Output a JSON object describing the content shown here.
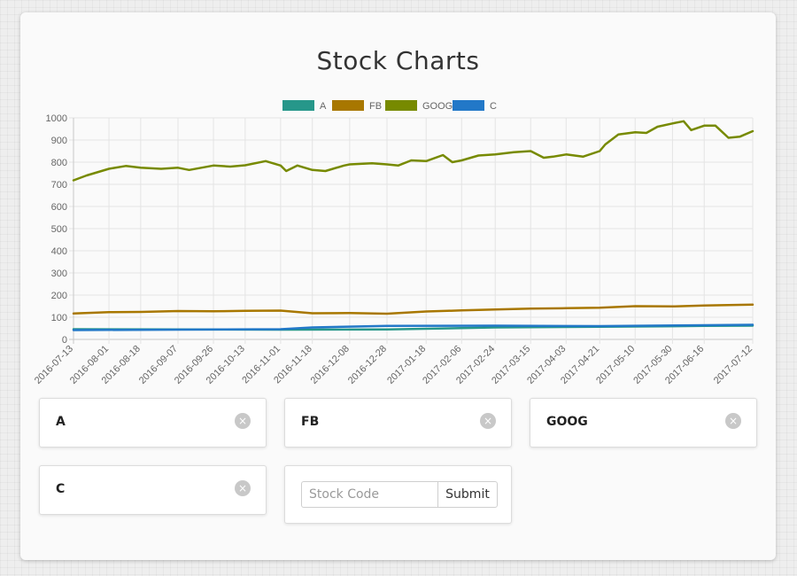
{
  "page": {
    "title": "Stock Charts"
  },
  "chart_data": {
    "type": "line",
    "ylim": [
      0,
      1000
    ],
    "yticks": [
      0,
      100,
      200,
      300,
      400,
      500,
      600,
      700,
      800,
      900,
      1000
    ],
    "xrange": [
      "2016-07-13",
      "2017-07-12"
    ],
    "xticks": [
      "2016-07-13",
      "2016-08-01",
      "2016-08-18",
      "2016-09-07",
      "2016-09-26",
      "2016-10-13",
      "2016-11-01",
      "2016-11-18",
      "2016-12-08",
      "2016-12-28",
      "2017-01-18",
      "2017-02-06",
      "2017-02-24",
      "2017-03-15",
      "2017-04-03",
      "2017-04-21",
      "2017-05-10",
      "2017-05-30",
      "2017-06-16",
      "2017-07-12"
    ],
    "grid": true,
    "legend_position": "top",
    "series": [
      {
        "name": "A",
        "color": "#26978a",
        "x": [
          "2016-07-13",
          "2016-09-07",
          "2016-11-01",
          "2016-12-28",
          "2017-02-24",
          "2017-04-21",
          "2017-06-16",
          "2017-07-12"
        ],
        "values": [
          46,
          45,
          44,
          45,
          54,
          57,
          61,
          62
        ]
      },
      {
        "name": "FB",
        "color": "#a87700",
        "x": [
          "2016-07-13",
          "2016-08-01",
          "2016-08-18",
          "2016-09-07",
          "2016-09-26",
          "2016-10-13",
          "2016-11-01",
          "2016-11-18",
          "2016-12-08",
          "2016-12-28",
          "2017-01-18",
          "2017-02-06",
          "2017-02-24",
          "2017-03-15",
          "2017-04-03",
          "2017-04-21",
          "2017-05-10",
          "2017-05-30",
          "2017-06-16",
          "2017-07-12"
        ],
        "values": [
          117,
          123,
          124,
          128,
          127,
          129,
          130,
          118,
          119,
          116,
          126,
          131,
          135,
          139,
          141,
          143,
          150,
          149,
          153,
          157
        ]
      },
      {
        "name": "GOOG",
        "color": "#778a00",
        "x": [
          "2016-07-13",
          "2016-07-20",
          "2016-08-01",
          "2016-08-10",
          "2016-08-18",
          "2016-08-29",
          "2016-09-07",
          "2016-09-13",
          "2016-09-26",
          "2016-10-05",
          "2016-10-13",
          "2016-10-24",
          "2016-11-01",
          "2016-11-04",
          "2016-11-10",
          "2016-11-18",
          "2016-11-25",
          "2016-12-05",
          "2016-12-08",
          "2016-12-20",
          "2016-12-28",
          "2017-01-03",
          "2017-01-10",
          "2017-01-18",
          "2017-01-27",
          "2017-02-01",
          "2017-02-06",
          "2017-02-15",
          "2017-02-24",
          "2017-03-06",
          "2017-03-15",
          "2017-03-22",
          "2017-03-27",
          "2017-04-03",
          "2017-04-12",
          "2017-04-21",
          "2017-04-24",
          "2017-05-01",
          "2017-05-10",
          "2017-05-16",
          "2017-05-22",
          "2017-05-30",
          "2017-06-05",
          "2017-06-09",
          "2017-06-16",
          "2017-06-22",
          "2017-06-29",
          "2017-07-05",
          "2017-07-12"
        ],
        "values": [
          718,
          740,
          770,
          783,
          775,
          770,
          775,
          765,
          785,
          780,
          786,
          805,
          785,
          760,
          785,
          765,
          760,
          785,
          790,
          795,
          790,
          785,
          808,
          805,
          832,
          800,
          808,
          830,
          835,
          845,
          850,
          820,
          825,
          835,
          825,
          850,
          880,
          925,
          935,
          932,
          960,
          975,
          985,
          945,
          965,
          965,
          910,
          915,
          940
        ]
      },
      {
        "name": "C",
        "color": "#2278c8",
        "x": [
          "2016-07-13",
          "2016-09-07",
          "2016-11-01",
          "2016-11-18",
          "2016-12-28",
          "2017-02-24",
          "2017-04-21",
          "2017-06-16",
          "2017-07-12"
        ],
        "values": [
          42,
          44,
          46,
          54,
          61,
          62,
          60,
          64,
          66
        ]
      }
    ]
  },
  "stocks": {
    "items": [
      {
        "code": "A",
        "remove_glyph": "×"
      },
      {
        "code": "FB",
        "remove_glyph": "×"
      },
      {
        "code": "GOOG",
        "remove_glyph": "×"
      },
      {
        "code": "C",
        "remove_glyph": "×"
      }
    ]
  },
  "form": {
    "placeholder": "Stock Code",
    "submit_label": "Submit",
    "value": ""
  }
}
